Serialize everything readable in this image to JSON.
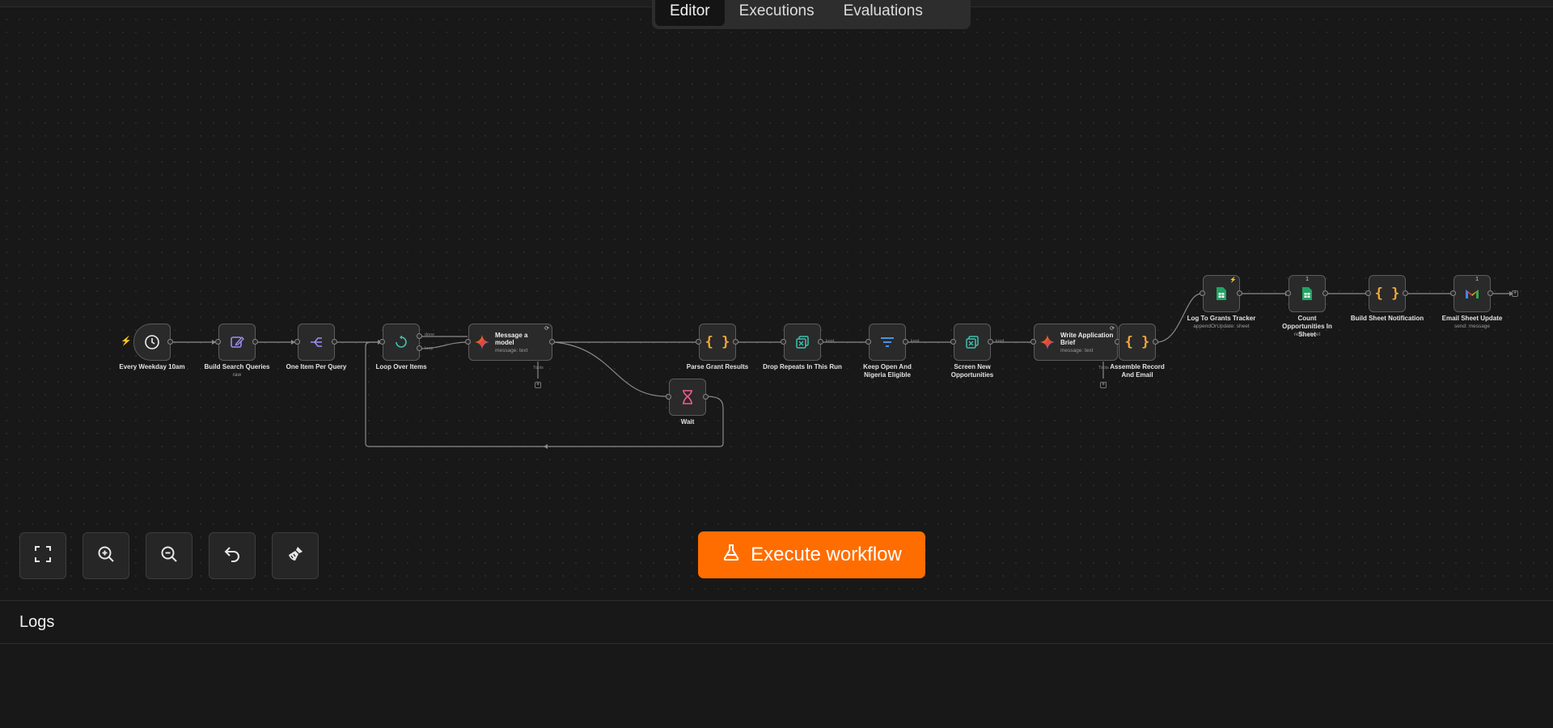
{
  "tabs": [
    {
      "label": "Editor",
      "active": true
    },
    {
      "label": "Executions",
      "active": false
    },
    {
      "label": "Evaluations",
      "active": false
    }
  ],
  "workflow": {
    "nodes": [
      {
        "id": "schedule",
        "label": "Every Weekday 10am",
        "icon": "clock-icon"
      },
      {
        "id": "build",
        "label": "Build Search Queries",
        "sub": "raw",
        "icon": "pencil-edit-icon"
      },
      {
        "id": "split",
        "label": "One Item Per Query",
        "icon": "split-out-icon"
      },
      {
        "id": "loop",
        "label": "Loop Over Items",
        "icon": "loop-icon",
        "ports": [
          "done",
          "loop"
        ]
      },
      {
        "id": "model1",
        "title": "Message a model",
        "sub": "message: text",
        "icon": "gemini-icon",
        "port": "Tools"
      },
      {
        "id": "wait",
        "label": "Wait",
        "icon": "hourglass-icon"
      },
      {
        "id": "parse",
        "label": "Parse Grant Results",
        "icon": "code-braces-icon"
      },
      {
        "id": "dedupe",
        "label": "Drop Repeats In This Run",
        "icon": "remove-duplicates-icon",
        "port": "kept"
      },
      {
        "id": "filter",
        "label": "Keep Open And Nigeria Eligible",
        "icon": "filter-icon",
        "port": "kept"
      },
      {
        "id": "screen",
        "label": "Screen New Opportunities",
        "icon": "remove-duplicates-icon",
        "port": "kept"
      },
      {
        "id": "model2",
        "title": "Write Application Brief",
        "sub": "message: text",
        "icon": "gemini-icon",
        "port": "Tools"
      },
      {
        "id": "assemble",
        "label": "Assemble Record And Email",
        "icon": "code-braces-icon"
      },
      {
        "id": "log",
        "label": "Log To Grants Tracker",
        "sub": "appendOrUpdate: sheet",
        "icon": "google-sheets-icon"
      },
      {
        "id": "count",
        "label": "Count Opportunities In Sheet",
        "sub": "read: sheet",
        "icon": "google-sheets-icon",
        "badge": "1"
      },
      {
        "id": "notify",
        "label": "Build Sheet Notification",
        "icon": "code-braces-icon"
      },
      {
        "id": "email",
        "label": "Email Sheet Update",
        "sub": "send: message",
        "icon": "gmail-icon",
        "badge": "1"
      }
    ]
  },
  "controls": [
    {
      "name": "fit-view",
      "icon": "fullscreen-icon"
    },
    {
      "name": "zoom-in",
      "icon": "zoom-in-icon"
    },
    {
      "name": "zoom-out",
      "icon": "zoom-out-icon"
    },
    {
      "name": "undo",
      "icon": "undo-icon"
    },
    {
      "name": "tidy-up",
      "icon": "broom-icon"
    }
  ],
  "execute_label": "Execute workflow",
  "logs_title": "Logs",
  "colors": {
    "accent": "#ff6d00",
    "canvas": "#181818",
    "node": "#2a2a2a",
    "node_border": "#5c5c5c",
    "code": "#f0a83c",
    "purple": "#9b8cf5",
    "teal": "#3fc1b0",
    "filter_blue": "#4aa3ff",
    "wait_pink": "#f45b8a",
    "sheets_green": "#21a464"
  }
}
